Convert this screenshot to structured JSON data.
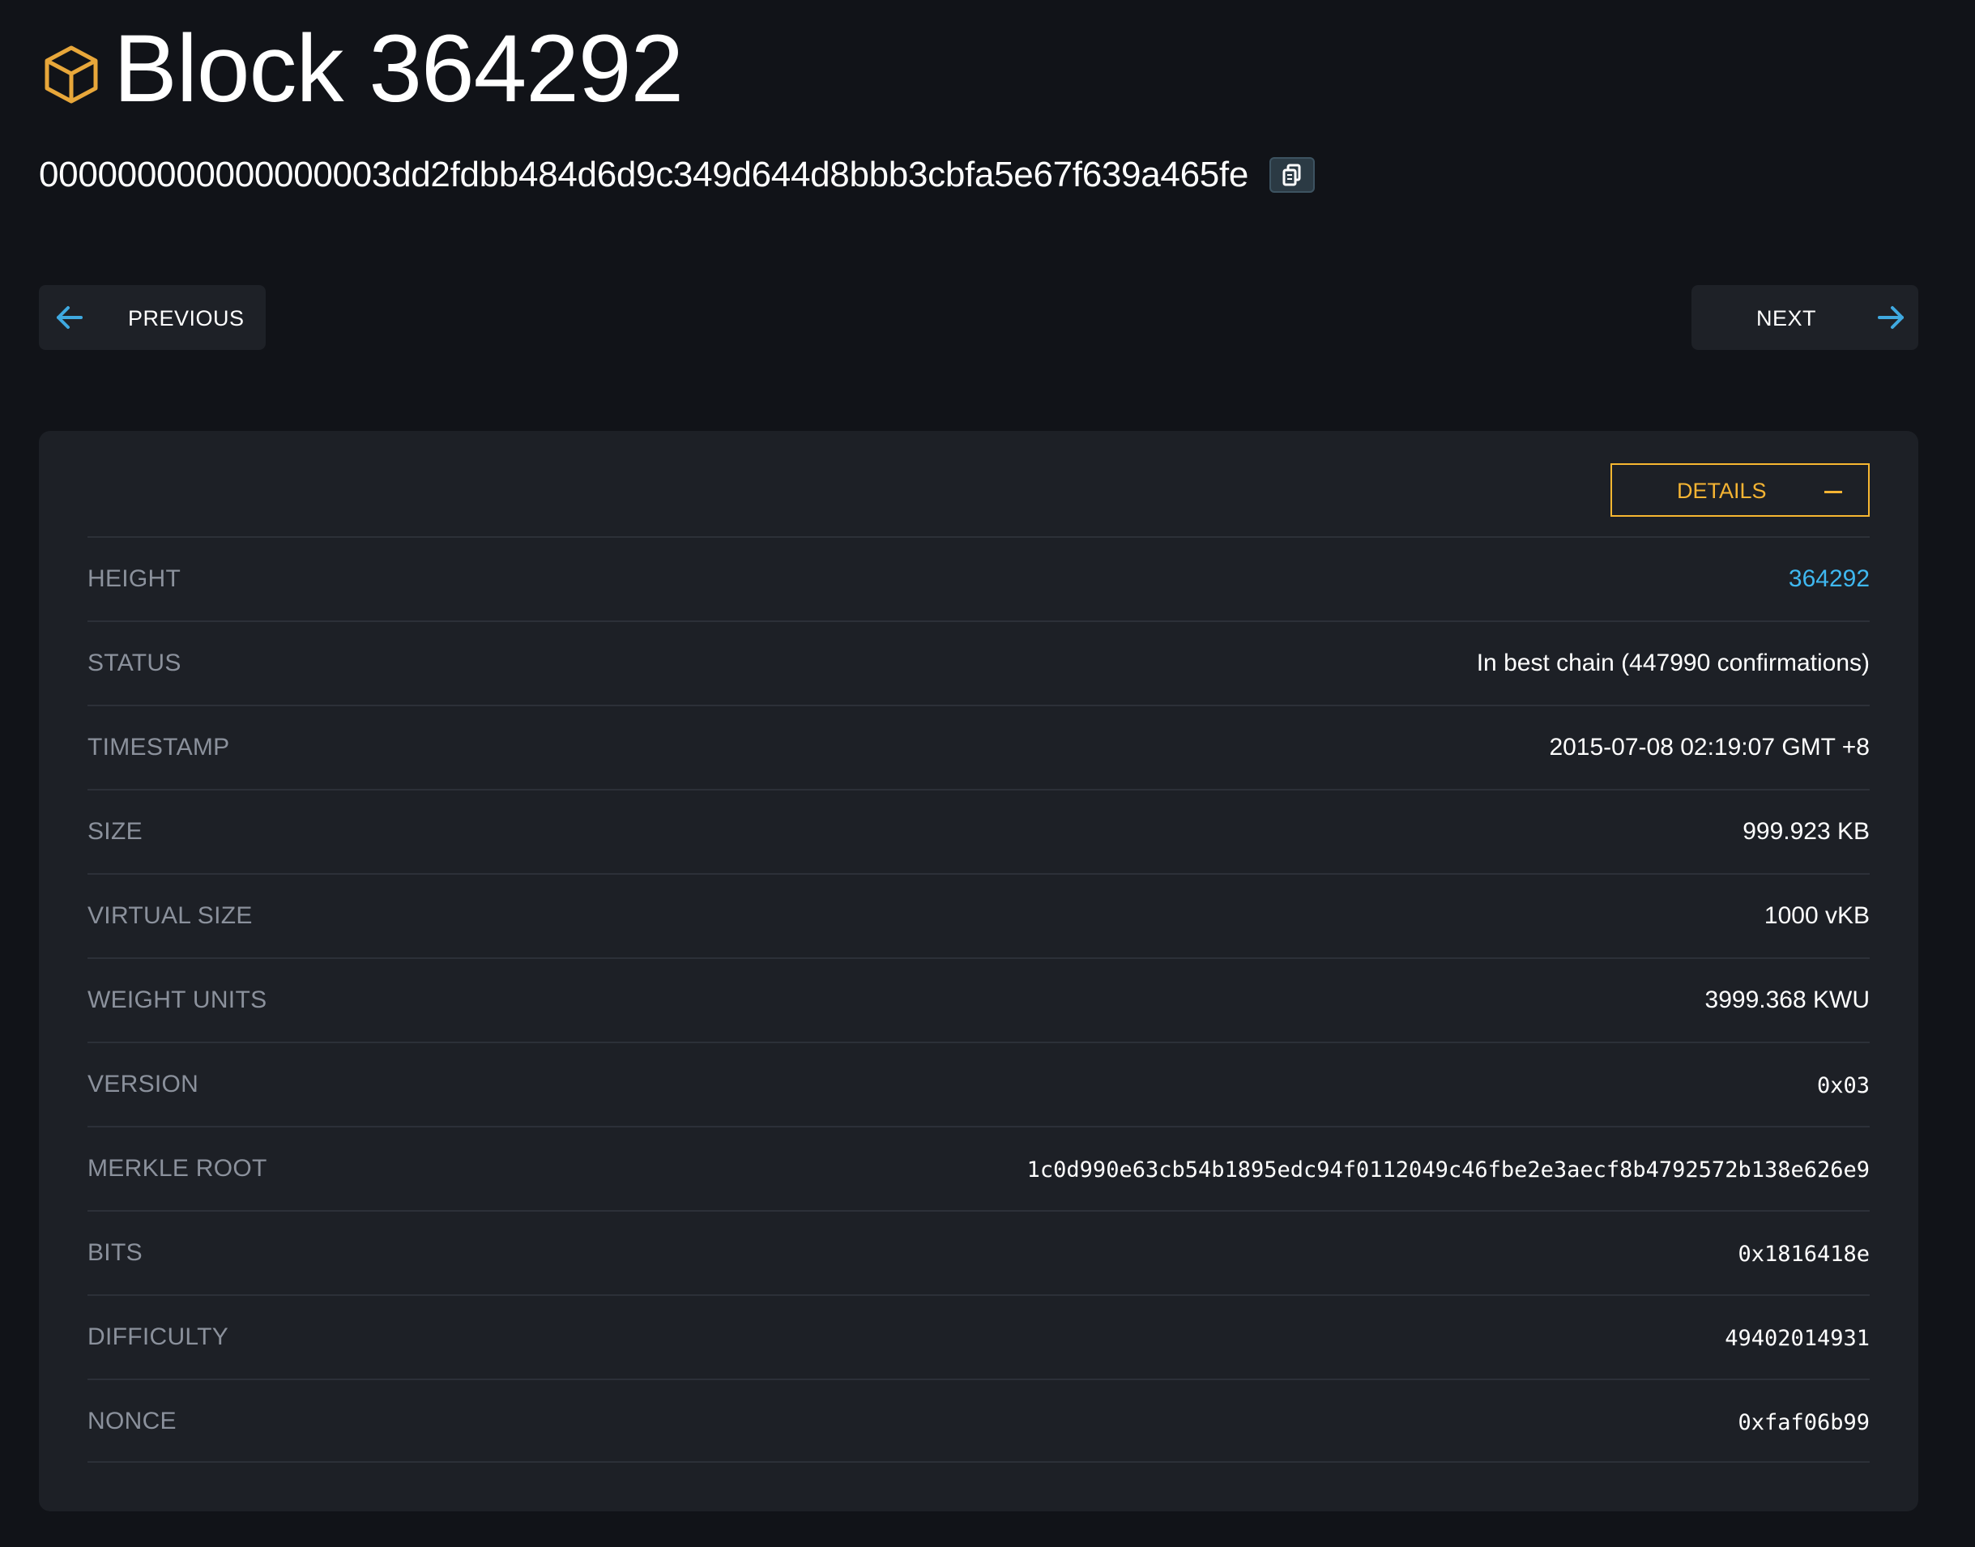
{
  "header": {
    "title": "Block 364292",
    "hash": "000000000000000003dd2fdbb484d6d9c349d644d8bbb3cbfa5e67f639a465fe"
  },
  "icons": {
    "block": "cube-icon",
    "copy": "copy-icon",
    "previous": "arrow-left-icon",
    "next": "arrow-right-icon",
    "collapse": "minus-icon"
  },
  "navigation": {
    "previous_label": "PREVIOUS",
    "next_label": "NEXT"
  },
  "details": {
    "toggle_label": "DETAILS",
    "rows": [
      {
        "key": "HEIGHT",
        "value": "364292"
      },
      {
        "key": "STATUS",
        "value": "In best chain (447990 confirmations)"
      },
      {
        "key": "TIMESTAMP",
        "value": "2015-07-08 02:19:07 GMT +8"
      },
      {
        "key": "SIZE",
        "value": "999.923 KB"
      },
      {
        "key": "VIRTUAL SIZE",
        "value": "1000 vKB"
      },
      {
        "key": "WEIGHT UNITS",
        "value": "3999.368 KWU"
      },
      {
        "key": "VERSION",
        "value": "0x03"
      },
      {
        "key": "MERKLE ROOT",
        "value": "1c0d990e63cb54b1895edc94f0112049c46fbe2e3aecf8b4792572b138e626e9"
      },
      {
        "key": "BITS",
        "value": "0x1816418e"
      },
      {
        "key": "DIFFICULTY",
        "value": "49402014931"
      },
      {
        "key": "NONCE",
        "value": "0xfaf06b99"
      }
    ]
  },
  "colors": {
    "background": "#111318",
    "card": "#1d2026",
    "accent": "#f5b433",
    "link": "#3fb8f0",
    "label": "#8b919c"
  }
}
